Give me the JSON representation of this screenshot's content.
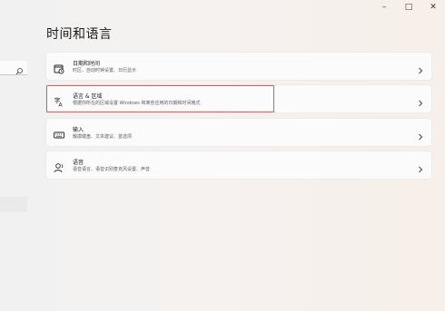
{
  "window": {
    "minimize_glyph": "–",
    "maximize_glyph": "□",
    "close_glyph": "✕"
  },
  "page": {
    "title": "时间和语言"
  },
  "cards": [
    {
      "title": "日期和时间",
      "subtitle": "时区、自动时钟设置、日历显示",
      "icon": "clock-calendar-icon"
    },
    {
      "title": "语言 & 区域",
      "subtitle": "根据你所在的区域设置 Windows 和某些应用的日期和时间格式",
      "icon": "language-region-icon"
    },
    {
      "title": "输入",
      "subtitle": "触摸键盘、文本建议、首选项",
      "icon": "keyboard-icon"
    },
    {
      "title": "语音",
      "subtitle": "语音语言、语音识别麦克风设置、声音",
      "icon": "speech-icon"
    }
  ],
  "colors": {
    "highlight_border": "#e25555"
  }
}
